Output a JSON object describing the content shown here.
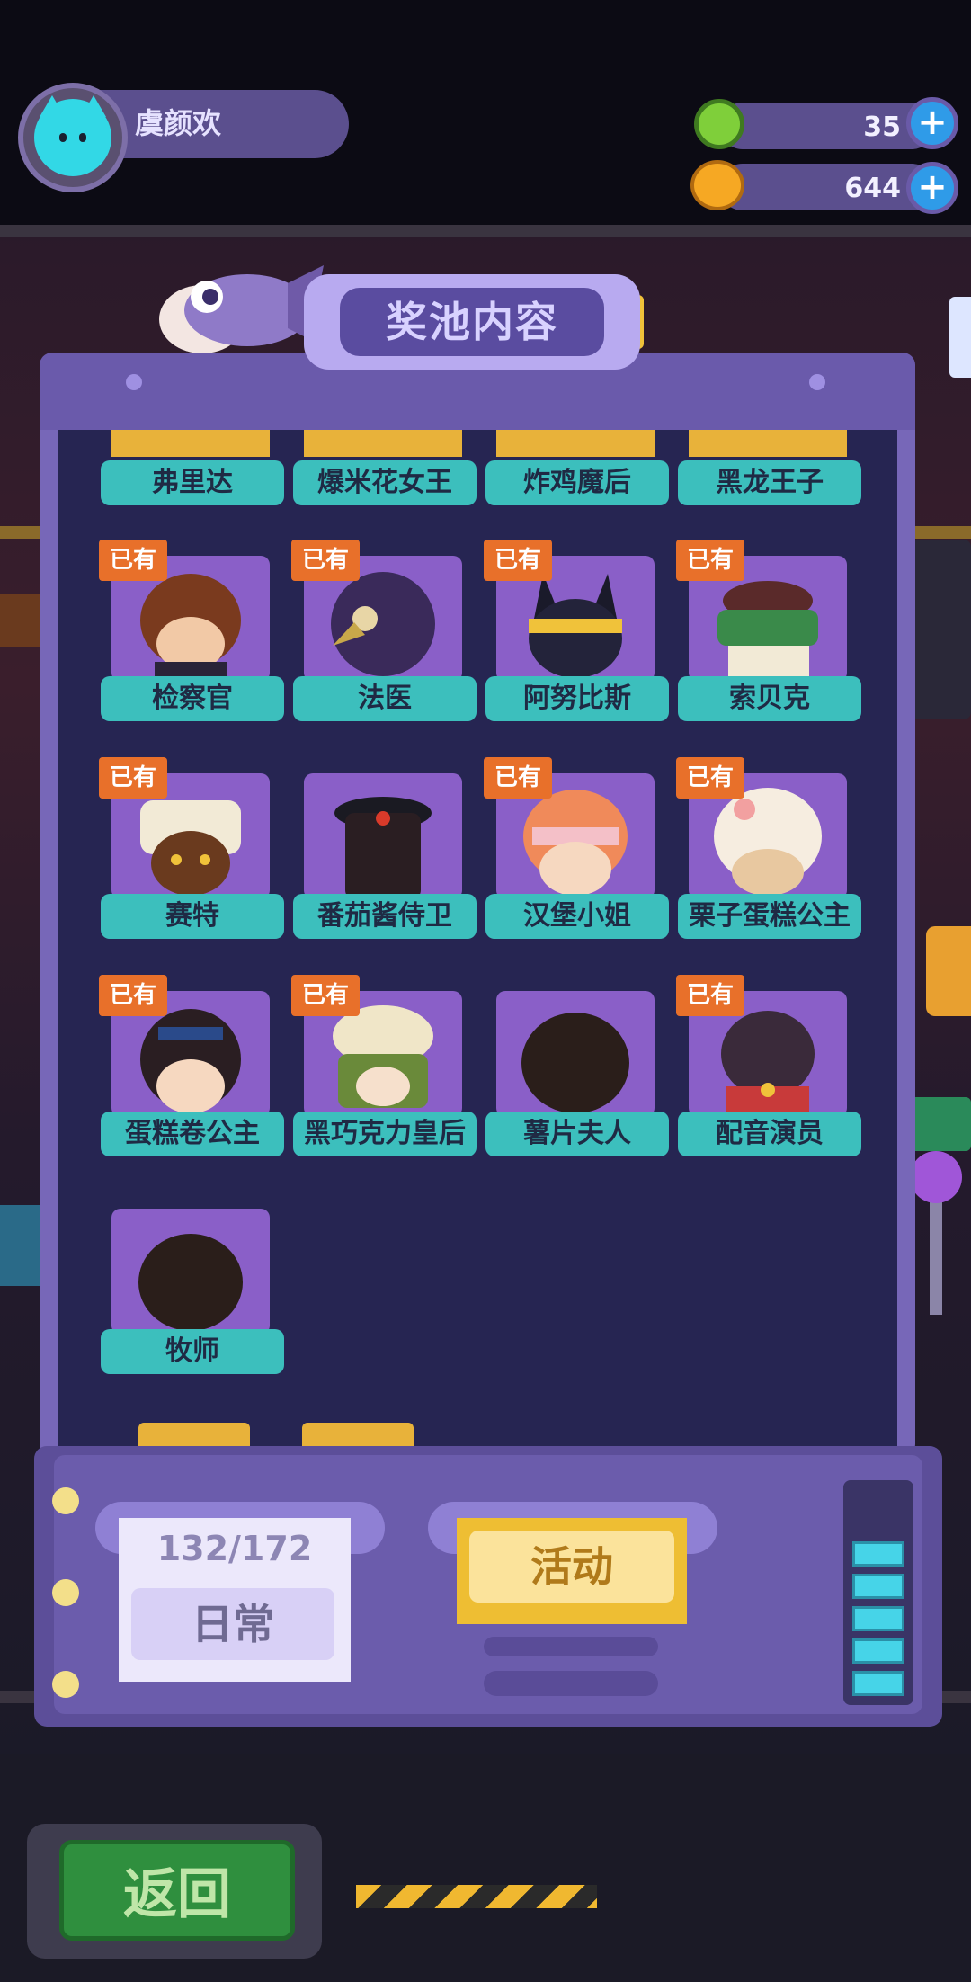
{
  "header": {
    "username": "虞颜欢",
    "green_currency": "35",
    "gold_currency": "644"
  },
  "panel": {
    "title": "奖池内容",
    "owned_label": "已有",
    "top_row": [
      "弗里达",
      "爆米花女王",
      "炸鸡魔后",
      "黑龙王子"
    ],
    "items": [
      {
        "name": "检察官",
        "owned": true
      },
      {
        "name": "法医",
        "owned": true
      },
      {
        "name": "阿努比斯",
        "owned": true
      },
      {
        "name": "索贝克",
        "owned": true
      },
      {
        "name": "赛特",
        "owned": true
      },
      {
        "name": "番茄酱侍卫",
        "owned": false
      },
      {
        "name": "汉堡小姐",
        "owned": true
      },
      {
        "name": "栗子蛋糕公主",
        "owned": true
      },
      {
        "name": "蛋糕卷公主",
        "owned": true
      },
      {
        "name": "黑巧克力皇后",
        "owned": true
      },
      {
        "name": "薯片夫人",
        "owned": false
      },
      {
        "name": "配音演员",
        "owned": true
      },
      {
        "name": "牧师",
        "owned": false
      }
    ]
  },
  "controls": {
    "daily_counter": "132/172",
    "daily_label": "日常",
    "event_label": "活动"
  },
  "footer": {
    "back_label": "返回"
  },
  "colors": {
    "accent_teal": "#3cbfbd",
    "owned_badge": "#e8702a",
    "panel": "#7767b8"
  }
}
